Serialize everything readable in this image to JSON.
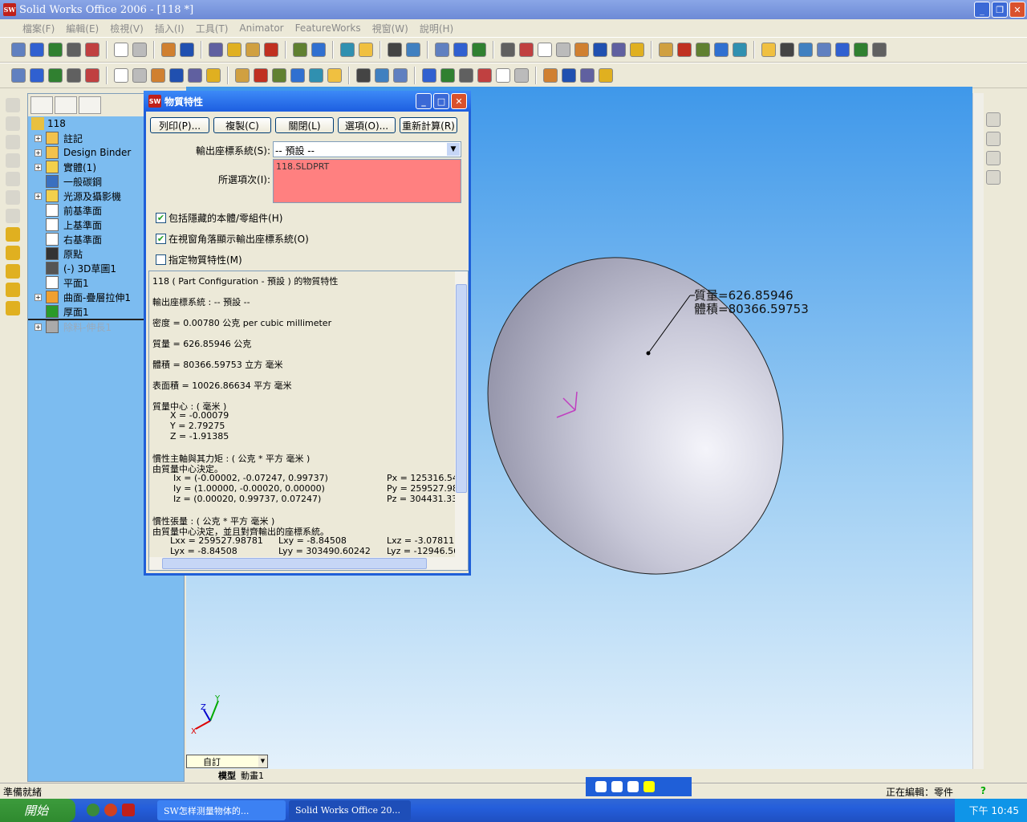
{
  "window": {
    "title": "Solid Works Office 2006 - [118 *]",
    "logo": "SW"
  },
  "menu": [
    "檔案(F)",
    "編輯(E)",
    "檢視(V)",
    "插入(I)",
    "工具(T)",
    "Animator",
    "FeatureWorks",
    "視窗(W)",
    "說明(H)"
  ],
  "tree": {
    "root": "118",
    "items": [
      {
        "label": "註記",
        "expand": true,
        "icon": "annotation-icon",
        "color": "#f3c24c"
      },
      {
        "label": "Design Binder",
        "expand": true,
        "icon": "design-binder-icon",
        "color": "#f3c24c"
      },
      {
        "label": "實體(1)",
        "expand": true,
        "icon": "solid-bodies-icon",
        "color": "#f3d04c"
      },
      {
        "label": "一般碳鋼",
        "expand": false,
        "icon": "material-icon",
        "color": "#3a70c0"
      },
      {
        "label": "光源及攝影機",
        "expand": true,
        "icon": "lights-icon",
        "color": "#f3d04c"
      },
      {
        "label": "前基準面",
        "expand": false,
        "icon": "plane-icon",
        "color": "#ffffff"
      },
      {
        "label": "上基準面",
        "expand": false,
        "icon": "plane-icon",
        "color": "#ffffff"
      },
      {
        "label": "右基準面",
        "expand": false,
        "icon": "plane-icon",
        "color": "#ffffff"
      },
      {
        "label": "原點",
        "expand": false,
        "icon": "origin-icon",
        "color": "#333333"
      },
      {
        "label": "(-) 3D草圖1",
        "expand": false,
        "icon": "sketch-3d-icon",
        "color": "#555555"
      },
      {
        "label": "平面1",
        "expand": false,
        "icon": "plane-icon",
        "color": "#ffffff"
      },
      {
        "label": "曲面-疊層拉伸1",
        "expand": true,
        "icon": "surface-loft-icon",
        "color": "#f0a030"
      },
      {
        "label": "厚面1",
        "expand": false,
        "icon": "thicken-icon",
        "color": "#2a9a2a"
      },
      {
        "label": "除料-伸長1",
        "expand": true,
        "icon": "cut-extrude-icon",
        "color": "#aaaaaa",
        "suppressed": true
      }
    ]
  },
  "dialog": {
    "title": "物質特性",
    "buttons": [
      "列印(P)...",
      "複製(C)",
      "關閉(L)",
      "選項(O)...",
      "重新計算(R)"
    ],
    "coord_label": "輸出座標系統(S):",
    "coord_value": "-- 預設 --",
    "selected_label": "所選項次(I):",
    "selected_item": "118.SLDPRT",
    "checkboxes": [
      {
        "label": "包括隱藏的本體/零組件(H)",
        "checked": true
      },
      {
        "label": "在視窗角落顯示輸出座標系統(O)",
        "checked": true
      },
      {
        "label": "指定物質特性(M)",
        "checked": false
      }
    ],
    "results": {
      "header": "118 ( Part Configuration - 預設 ) 的物質特性",
      "coord": "輸出座標系統 : -- 預設 --",
      "density": "密度 = 0.00780 公克 per cubic millimeter",
      "mass": "質量 = 626.85946 公克",
      "volume": "體積 = 80366.59753 立方 毫米",
      "area": "表面積 = 10026.86634 平方 毫米",
      "com_title": "質量中心 : ( 毫米 )",
      "com": [
        "X = -0.00079",
        "Y = 2.79275",
        "Z = -1.91385"
      ],
      "axes_title": "慣性主軸與其力矩 : ( 公克 * 平方 毫米 )",
      "axes_sub": "由質量中心決定。",
      "axes": [
        "Ix = (-0.00002, -0.07247, 0.99737)",
        "Iy = (1.00000, -0.00020, 0.00000)",
        "Iz = (0.00020, 0.99737, 0.07247)"
      ],
      "moments": [
        "Px = 125316.54",
        "Py = 259527.98",
        "Pz = 304431.33"
      ],
      "tensor_title": "慣性張量 : ( 公克 * 平方 毫米 )",
      "tensor_sub": "由質量中心決定，並且對齊輸出的座標系統。",
      "tensor": [
        [
          "Lxx = 259527.98781",
          "Lxy = -8.84508",
          "Lxz = -3.07811"
        ],
        [
          "Lyx = -8.84508",
          "Lyy = 303490.60242",
          "Lyz = -12946.56"
        ]
      ]
    }
  },
  "viewport": {
    "annotation": [
      "質量=626.85946",
      "體積=80366.59753"
    ],
    "view_orientation": "自訂",
    "tabs": [
      "模型",
      "動畫1"
    ]
  },
  "status": {
    "left": "準備就緒",
    "right": "正在編輯：零件"
  },
  "taskbar": {
    "start": "開始",
    "tasks": [
      "SW怎样测量物体的...",
      "Solid Works Office 20..."
    ],
    "clock": "下午 10:45"
  }
}
